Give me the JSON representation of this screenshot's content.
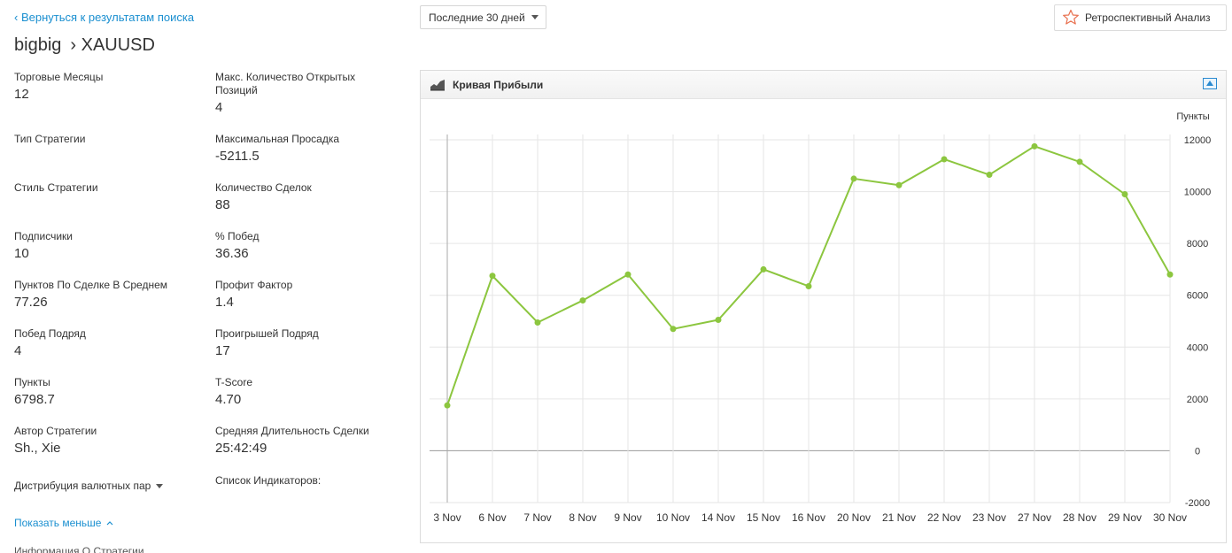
{
  "header": {
    "back_link": "‹ Вернуться к результатам поиска",
    "strategy_name": "bigbig",
    "symbol": "› XAUUSD",
    "period_select": "Последние 30 дней",
    "retro_button": "Ретроспективный Анализ"
  },
  "stats": {
    "col1": [
      {
        "label": "Торговые Месяцы",
        "value": "12"
      },
      {
        "label": "Тип Стратегии",
        "value": ""
      },
      {
        "label": "Стиль Стратегии",
        "value": ""
      },
      {
        "label": "Подписчики",
        "value": "10"
      },
      {
        "label": "Пунктов По Сделке В Среднем",
        "value": "77.26"
      },
      {
        "label": "Побед Подряд",
        "value": "4"
      },
      {
        "label": "Пункты",
        "value": "6798.7"
      },
      {
        "label": "Автор Стратегии",
        "value": "Sh., Xie"
      }
    ],
    "col2": [
      {
        "label": "Макс. Количество Открытых Позиций",
        "value": "4"
      },
      {
        "label": "Максимальная Просадка",
        "value": "-5211.5"
      },
      {
        "label": "Количество Сделок",
        "value": "88"
      },
      {
        "label": "% Побед",
        "value": "36.36"
      },
      {
        "label": "Профит Фактор",
        "value": "1.4"
      },
      {
        "label": "Проигрышей Подряд",
        "value": "17"
      },
      {
        "label": "T-Score",
        "value": "4.70"
      },
      {
        "label": "Средняя Длительность Сделки",
        "value": "25:42:49"
      }
    ],
    "distribution_toggle": "Дистрибуция валютных пар",
    "indicators_label": "Список Индикаторов:",
    "show_less": "Показать меньше",
    "cutoff_text": "Информация О Стратегии"
  },
  "panel": {
    "title": "Кривая Прибыли",
    "icons": {
      "chart": "area-chart-icon",
      "collapse": "collapse-icon",
      "star": "star-icon"
    }
  },
  "colors": {
    "link": "#1a8fd0",
    "line": "#8cc63f",
    "star": "#e8704f"
  },
  "chart_data": {
    "type": "line",
    "title": "Кривая Прибыли",
    "xlabel": "",
    "ylabel": "Пункты",
    "y_axis_side": "right",
    "ylim": [
      -2000,
      12000
    ],
    "yticks": [
      12000,
      10000,
      8000,
      6000,
      4000,
      2000,
      0,
      -2000
    ],
    "categories": [
      "3 Nov",
      "6 Nov",
      "7 Nov",
      "8 Nov",
      "9 Nov",
      "10 Nov",
      "14 Nov",
      "15 Nov",
      "16 Nov",
      "20 Nov",
      "21 Nov",
      "22 Nov",
      "23 Nov",
      "27 Nov",
      "28 Nov",
      "29 Nov",
      "30 Nov"
    ],
    "series": [
      {
        "values": [
          1750,
          6750,
          4950,
          5800,
          6800,
          4700,
          5050,
          7000,
          6350,
          10500,
          10250,
          11250,
          10650,
          11750,
          11150,
          9900,
          6800
        ]
      }
    ],
    "grid": true,
    "legend": "none"
  }
}
